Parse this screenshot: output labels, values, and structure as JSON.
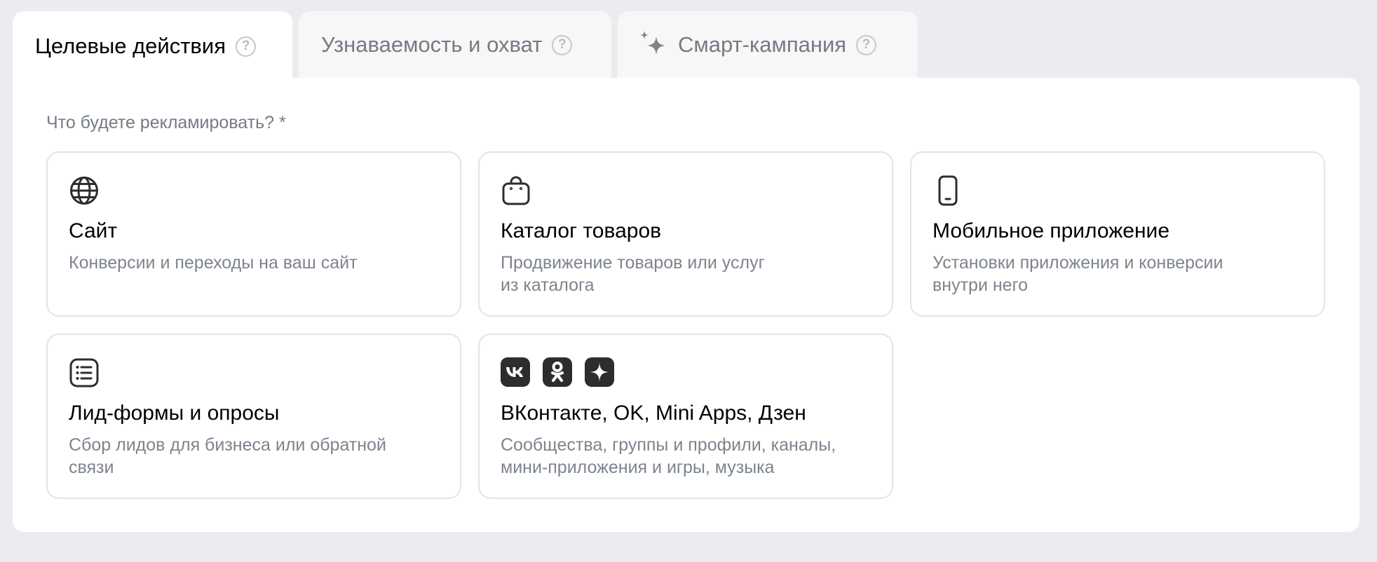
{
  "tabs": [
    {
      "label": "Целевые действия",
      "active": true
    },
    {
      "label": "Узнаваемость и охват",
      "active": false
    },
    {
      "label": "Смарт-кампания",
      "active": false
    }
  ],
  "help_glyph": "?",
  "question": "Что будете рекламировать? *",
  "cards": {
    "site": {
      "title": "Сайт",
      "desc": "Конверсии и переходы на ваш сайт",
      "icon": "globe-icon"
    },
    "catalog": {
      "title": "Каталог товаров",
      "desc": "Продвижение товаров или услуг\nиз каталога",
      "icon": "shopping-bag-icon"
    },
    "mobile": {
      "title": "Мобильное приложение",
      "desc": "Установки приложения и конверсии\nвнутри него",
      "icon": "smartphone-icon"
    },
    "leads": {
      "title": "Лид-формы и опросы",
      "desc": "Сбор лидов для бизнеса или обратной\nсвязи",
      "icon": "list-form-icon"
    },
    "vk": {
      "title": "ВКонтакте, OK, Mini Apps, Дзен",
      "desc": "Сообщества, группы и профили, каналы,\nмини-приложения и игры, музыка",
      "icons": [
        "vk-logo-icon",
        "ok-logo-icon",
        "dzen-logo-icon"
      ]
    }
  },
  "colors": {
    "background": "#ebecef",
    "panel": "#ffffff",
    "muted_text": "#747b85",
    "card_border": "#e2e4e8",
    "brand_icon_bg": "#2c2d2e"
  }
}
